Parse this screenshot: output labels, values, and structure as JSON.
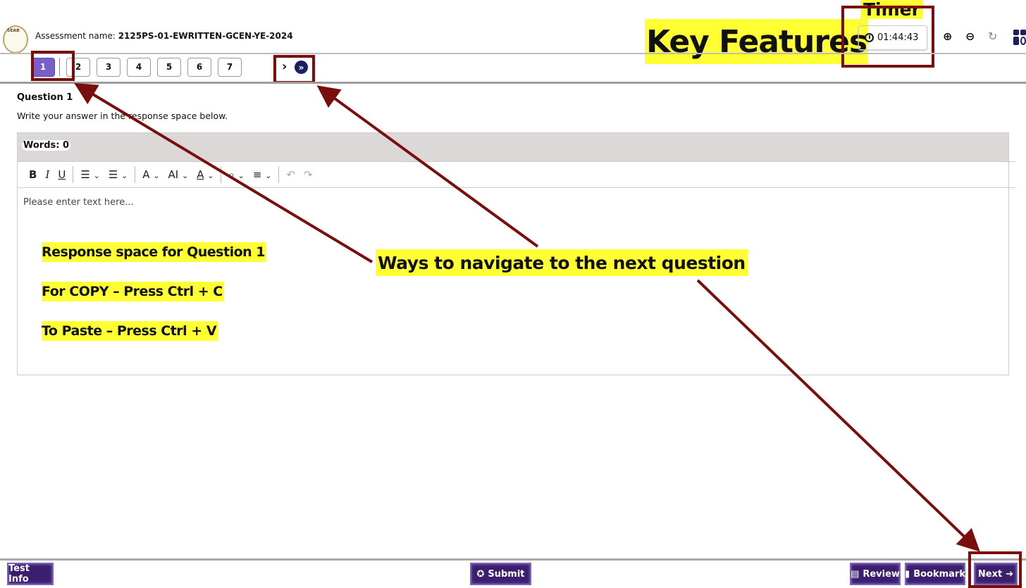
{
  "header": {
    "logo_text": "SEAB",
    "assessment_label": "Assessment name:",
    "assessment_name": "2125PS-01-EWRITTEN-GCEN-YE-2024",
    "timer": "01:44:43",
    "icons": [
      "zoom-in-icon",
      "zoom-out-icon",
      "reset-icon",
      "grid-menu-icon"
    ]
  },
  "question_nav": {
    "questions": [
      "1",
      "2",
      "3",
      "4",
      "5",
      "6",
      "7"
    ],
    "active": "1",
    "next_chevron": "›",
    "fast_forward": "»"
  },
  "question": {
    "title": "Question 1",
    "instruction": "Write your answer in the response space below.",
    "word_count_label": "Words: 0",
    "placeholder": "Please enter text here...",
    "toolbar": {
      "bold": "B",
      "italic": "I",
      "underline": "U",
      "bullet_list": "☰",
      "numbered_list": "☰",
      "font_size": "A",
      "text_case": "AI",
      "font_color": "A",
      "find_replace": "⌕",
      "align": "≡",
      "undo": "↶",
      "redo": "↷",
      "dropdown": "⌄"
    }
  },
  "annotations": {
    "key_features": "Key Features",
    "timer_label": "Timer",
    "ways_to_navigate": "Ways to navigate to the next question",
    "response_space": "Response space for Question 1",
    "copy_hint": "For COPY – Press Ctrl + C",
    "paste_hint": "To Paste – Press Ctrl + V",
    "annotation_color": "#7a0e0e",
    "highlight_color": "#ffff33"
  },
  "footer": {
    "test_info": "Test Info",
    "submit": "Submit",
    "review": "Review",
    "bookmark": "Bookmark",
    "next": "Next",
    "button_color": "#3b1f6e"
  }
}
